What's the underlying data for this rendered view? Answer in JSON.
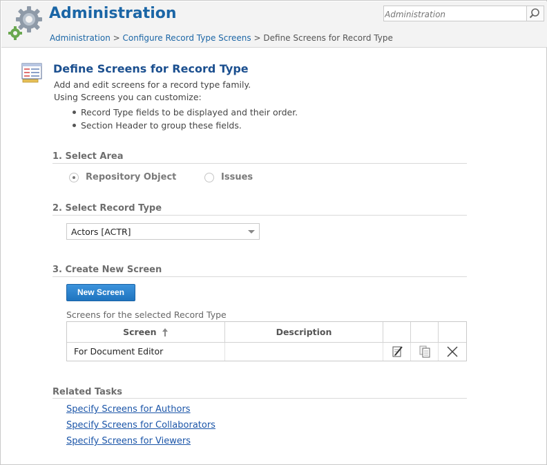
{
  "header": {
    "title": "Administration",
    "search_placeholder": "Administration",
    "breadcrumb": {
      "items": [
        "Administration",
        "Configure Record Type Screens"
      ],
      "separator": ">",
      "current": "Define Screens for Record Type"
    }
  },
  "page": {
    "title": "Define Screens for Record Type",
    "description_lines": [
      "Add and edit screens for a record type family.",
      "Using Screens you can customize:"
    ],
    "bullets": [
      "Record Type fields to be displayed and their order.",
      "Section Header to group these fields."
    ]
  },
  "select_area": {
    "heading": "1. Select Area",
    "options": [
      {
        "label": "Repository Object",
        "selected": true
      },
      {
        "label": "Issues",
        "selected": false
      }
    ]
  },
  "select_record_type": {
    "heading": "2. Select Record Type",
    "selected_value": "Actors [ACTR]"
  },
  "create_screen": {
    "heading": "3. Create New Screen",
    "button_label": "New Screen",
    "table_caption": "Screens for the selected Record Type",
    "columns": [
      "Screen",
      "Description",
      "",
      "",
      ""
    ],
    "rows": [
      {
        "screen": "For Document Editor",
        "description": ""
      }
    ]
  },
  "related_tasks": {
    "heading": "Related Tasks",
    "links": [
      "Specify Screens for Authors",
      "Specify Screens for Collaborators",
      "Specify Screens for Viewers"
    ]
  },
  "colors": {
    "brand_blue": "#1b66a6",
    "primary_button": "#2a82cf",
    "link": "#1b55a8"
  },
  "icons": [
    "gear-icon",
    "search-icon",
    "record-type-form-icon",
    "sort-ascending-icon",
    "edit-icon",
    "copy-icon",
    "delete-icon"
  ]
}
